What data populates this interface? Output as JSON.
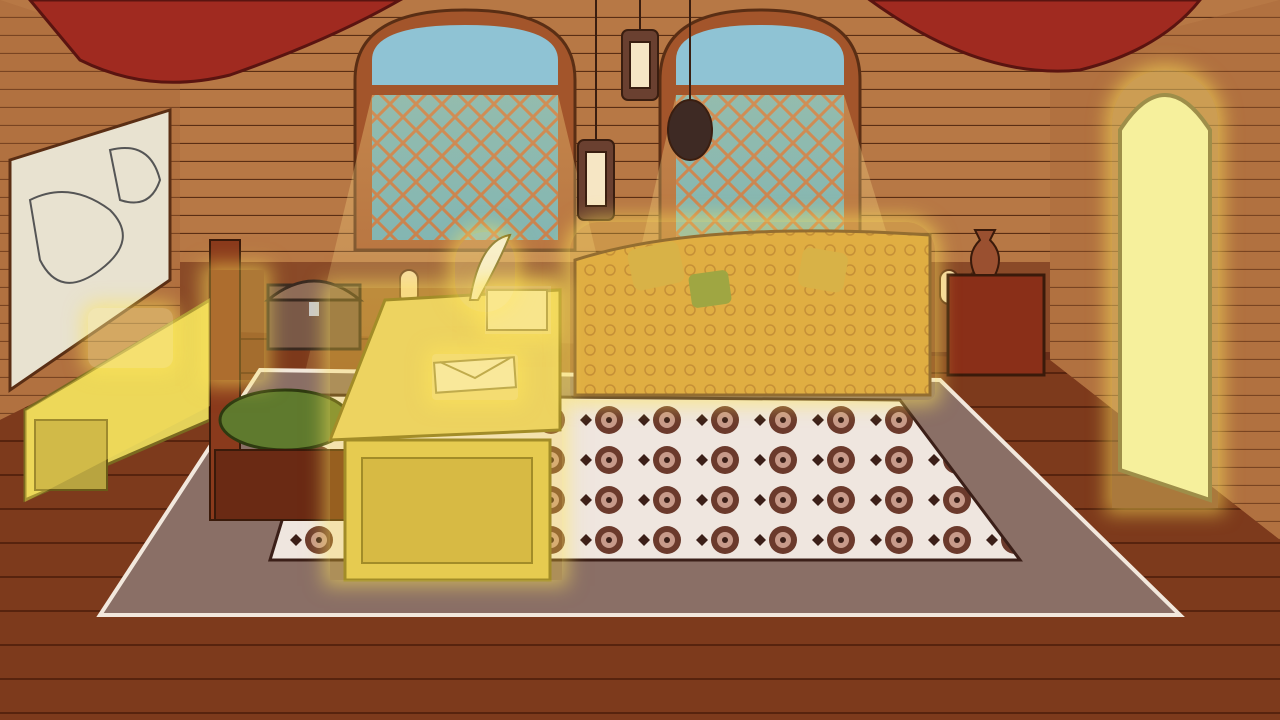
{
  "scene": {
    "name": "ship-captain-cabin",
    "interactive_objects": [
      {
        "id": "dresser",
        "icon": "dresser-icon",
        "highlighted": true
      },
      {
        "id": "scroll-papers",
        "icon": "scroll-icon",
        "highlighted": true
      },
      {
        "id": "desk",
        "icon": "desk-icon",
        "highlighted": true
      },
      {
        "id": "letters",
        "icon": "letter-icon",
        "highlighted": true
      },
      {
        "id": "ink-and-quill",
        "icon": "quill-icon",
        "highlighted": true
      },
      {
        "id": "wooden-box",
        "icon": "box-icon",
        "highlighted": true
      },
      {
        "id": "sofa",
        "icon": "sofa-icon",
        "highlighted": true
      },
      {
        "id": "cabin-door",
        "icon": "door-icon",
        "highlighted": true
      },
      {
        "id": "chair-back",
        "icon": "chair-icon",
        "highlighted": true
      }
    ],
    "decorations": [
      {
        "id": "world-map",
        "icon": "map-icon"
      },
      {
        "id": "treasure-chest",
        "icon": "chest-icon"
      },
      {
        "id": "hanging-lanterns",
        "icon": "lantern-icon"
      },
      {
        "id": "arched-windows",
        "icon": "window-icon"
      },
      {
        "id": "red-curtains",
        "icon": "curtain-icon"
      },
      {
        "id": "copper-pitcher",
        "icon": "pitcher-icon"
      },
      {
        "id": "patterned-rug",
        "icon": "rug-icon"
      }
    ],
    "colors": {
      "highlight": "#ffe45a",
      "wood_wall": "#b07040",
      "floor": "#7a3319",
      "curtain": "#a02a20",
      "sea": "#4f9fb7"
    }
  }
}
